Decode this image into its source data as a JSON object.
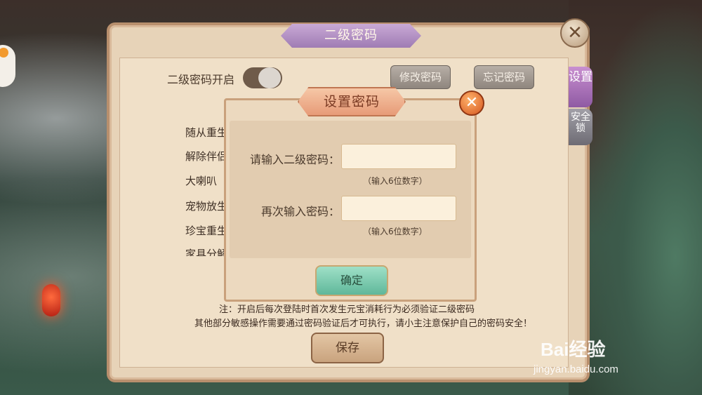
{
  "window": {
    "title": "二级密码",
    "close_symbol": "✕",
    "side_tabs": [
      {
        "label": "设置"
      },
      {
        "label": "安全锁"
      }
    ]
  },
  "password_settings": {
    "enable_label": "二级密码开启",
    "toggle_on": false,
    "change_button": "修改密码",
    "forgot_button": "忘记密码",
    "protected_items": [
      "随从重生",
      "解除伴侣",
      "大喇叭",
      "宠物放生",
      "珍宝重生",
      "家具分解"
    ],
    "note_line1": "注：开启后每次登陆时首次发生元宝消耗行为必须验证二级密码",
    "note_line2": "其他部分敏感操作需要通过密码验证后才可执行，请小主注意保护自己的密码安全！",
    "save_button": "保存"
  },
  "modal": {
    "title": "设置密码",
    "close_symbol": "✕",
    "field1_label": "请输入二级密码：",
    "field1_value": "",
    "field1_hint": "（输入6位数字）",
    "field2_label": "再次输入密码：",
    "field2_value": "",
    "field2_hint": "（输入6位数字）",
    "confirm_button": "确定"
  },
  "watermark": {
    "brand": "Bai经验",
    "url": "jingyan.baidu.com"
  },
  "colors": {
    "panel_bg": "#e7d3b8",
    "modal_title": "#e79b78",
    "confirm_button": "#5fb79a"
  }
}
